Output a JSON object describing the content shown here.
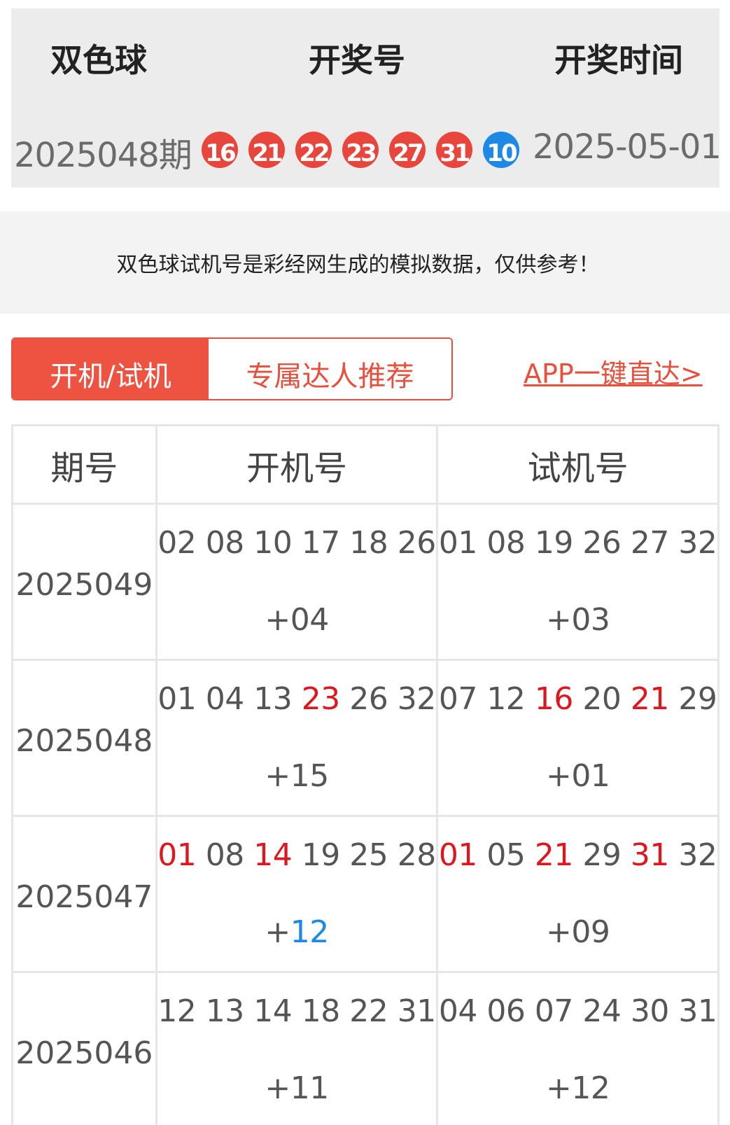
{
  "draw": {
    "headers": {
      "lottery": "双色球",
      "number": "开奖号",
      "time": "开奖时间"
    },
    "issue": "2025048期",
    "balls": [
      {
        "value": "16",
        "color": "red"
      },
      {
        "value": "21",
        "color": "red"
      },
      {
        "value": "22",
        "color": "red"
      },
      {
        "value": "23",
        "color": "red"
      },
      {
        "value": "27",
        "color": "red"
      },
      {
        "value": "31",
        "color": "red"
      },
      {
        "value": "10",
        "color": "blue"
      }
    ],
    "date": "2025-05-01"
  },
  "notice": "双色球试机号是彩经网生成的模拟数据，仅供参考！",
  "tabs": [
    {
      "label": "开机/试机",
      "active": true
    },
    {
      "label": "专属达人推荐",
      "active": false
    }
  ],
  "app_link": "APP一键直达>",
  "table": {
    "headers": [
      "期号",
      "开机号",
      "试机号"
    ],
    "rows": [
      {
        "issue": "2025049",
        "open": {
          "reds": [
            {
              "n": "02"
            },
            {
              "n": "08"
            },
            {
              "n": "10"
            },
            {
              "n": "17"
            },
            {
              "n": "18"
            },
            {
              "n": "26"
            }
          ],
          "blue": {
            "n": "04"
          }
        },
        "test": {
          "reds": [
            {
              "n": "01"
            },
            {
              "n": "08"
            },
            {
              "n": "19"
            },
            {
              "n": "26"
            },
            {
              "n": "27"
            },
            {
              "n": "32"
            }
          ],
          "blue": {
            "n": "03"
          }
        }
      },
      {
        "issue": "2025048",
        "open": {
          "reds": [
            {
              "n": "01"
            },
            {
              "n": "04"
            },
            {
              "n": "13"
            },
            {
              "n": "23",
              "hit": "red"
            },
            {
              "n": "26"
            },
            {
              "n": "32"
            }
          ],
          "blue": {
            "n": "15"
          }
        },
        "test": {
          "reds": [
            {
              "n": "07"
            },
            {
              "n": "12"
            },
            {
              "n": "16",
              "hit": "red"
            },
            {
              "n": "20"
            },
            {
              "n": "21",
              "hit": "red"
            },
            {
              "n": "29"
            }
          ],
          "blue": {
            "n": "01"
          }
        }
      },
      {
        "issue": "2025047",
        "open": {
          "reds": [
            {
              "n": "01",
              "hit": "red"
            },
            {
              "n": "08"
            },
            {
              "n": "14",
              "hit": "red"
            },
            {
              "n": "19"
            },
            {
              "n": "25"
            },
            {
              "n": "28"
            }
          ],
          "blue": {
            "n": "12",
            "hit": "blue"
          }
        },
        "test": {
          "reds": [
            {
              "n": "01",
              "hit": "red"
            },
            {
              "n": "05"
            },
            {
              "n": "21",
              "hit": "red"
            },
            {
              "n": "29"
            },
            {
              "n": "31",
              "hit": "red"
            },
            {
              "n": "32"
            }
          ],
          "blue": {
            "n": "09"
          }
        }
      },
      {
        "issue": "2025046",
        "open": {
          "reds": [
            {
              "n": "12"
            },
            {
              "n": "13"
            },
            {
              "n": "14"
            },
            {
              "n": "18"
            },
            {
              "n": "22"
            },
            {
              "n": "31"
            }
          ],
          "blue": {
            "n": "11"
          }
        },
        "test": {
          "reds": [
            {
              "n": "04"
            },
            {
              "n": "06"
            },
            {
              "n": "07"
            },
            {
              "n": "24"
            },
            {
              "n": "30"
            },
            {
              "n": "31"
            }
          ],
          "blue": {
            "n": "12"
          }
        }
      }
    ]
  }
}
